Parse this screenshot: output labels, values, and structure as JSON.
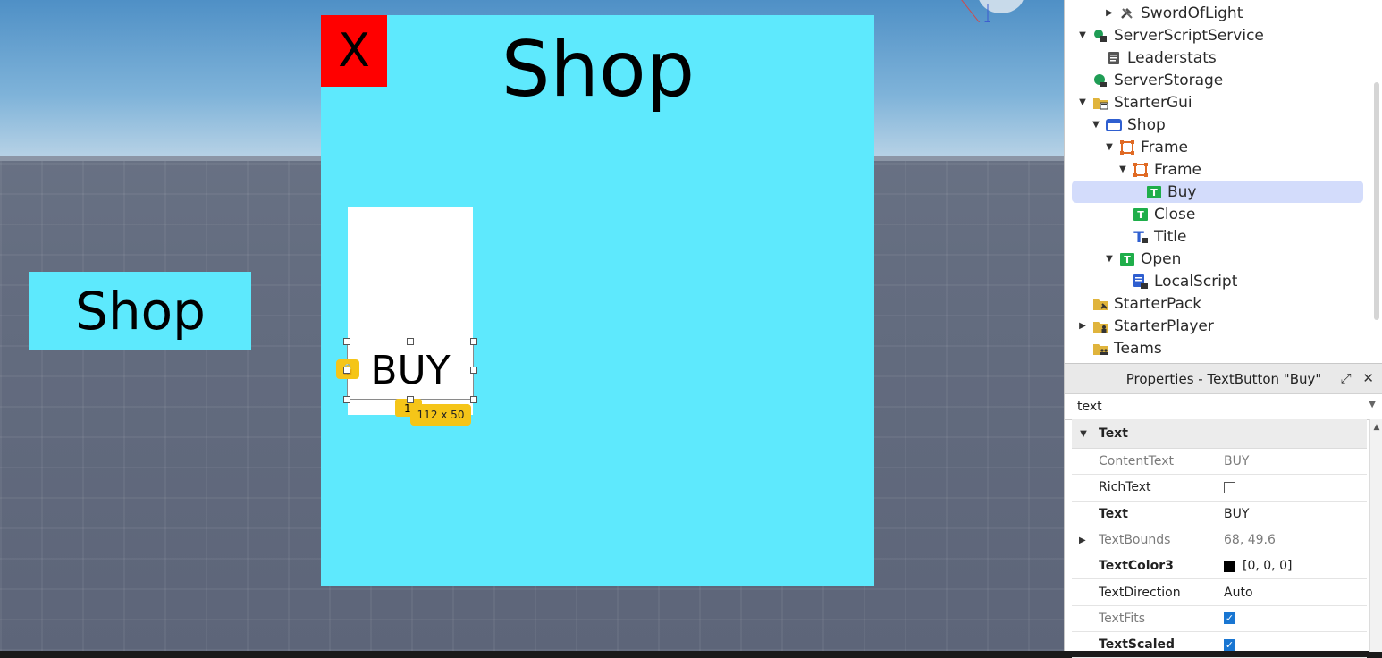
{
  "viewport": {
    "open_button": "Shop",
    "shop_frame": {
      "close_label": "X",
      "title": "Shop",
      "buy_label": "BUY",
      "size_tag": "112 x 50",
      "anchor_chip": "1"
    },
    "gizmo_axis": "Z"
  },
  "explorer": {
    "items": [
      {
        "label": "SwordOfLight",
        "icon": "tools-icon",
        "depth": 2,
        "arrow": "collapsed"
      },
      {
        "label": "ServerScriptService",
        "icon": "server-script-service-icon",
        "depth": 0,
        "arrow": "expanded"
      },
      {
        "label": "Leaderstats",
        "icon": "script-icon",
        "depth": 1,
        "arrow": "none"
      },
      {
        "label": "ServerStorage",
        "icon": "server-storage-icon",
        "depth": 0,
        "arrow": "none"
      },
      {
        "label": "StarterGui",
        "icon": "folder-gui-icon",
        "depth": 0,
        "arrow": "expanded"
      },
      {
        "label": "Shop",
        "icon": "screengui-icon",
        "depth": 1,
        "arrow": "expanded"
      },
      {
        "label": "Frame",
        "icon": "frame-icon",
        "depth": 2,
        "arrow": "expanded"
      },
      {
        "label": "Frame",
        "icon": "frame-icon",
        "depth": 3,
        "arrow": "expanded"
      },
      {
        "label": "Buy",
        "icon": "textbutton-icon",
        "depth": 4,
        "arrow": "none",
        "selected": true
      },
      {
        "label": "Close",
        "icon": "textbutton-icon",
        "depth": 3,
        "arrow": "none"
      },
      {
        "label": "Title",
        "icon": "textlabel-icon",
        "depth": 3,
        "arrow": "none"
      },
      {
        "label": "Open",
        "icon": "textbutton-icon",
        "depth": 2,
        "arrow": "expanded"
      },
      {
        "label": "LocalScript",
        "icon": "localscript-icon",
        "depth": 3,
        "arrow": "none"
      },
      {
        "label": "StarterPack",
        "icon": "folder-pack-icon",
        "depth": 0,
        "arrow": "none"
      },
      {
        "label": "StarterPlayer",
        "icon": "folder-player-icon",
        "depth": 0,
        "arrow": "collapsed"
      },
      {
        "label": "Teams",
        "icon": "folder-teams-icon",
        "depth": 0,
        "arrow": "none"
      }
    ]
  },
  "properties": {
    "header": "Properties - TextButton \"Buy\"",
    "filter_value": "text",
    "category": "Text",
    "rows": [
      {
        "name": "ContentText",
        "value": "BUY",
        "style": "dim"
      },
      {
        "name": "RichText",
        "type": "checkbox",
        "checked": false
      },
      {
        "name": "Text",
        "value": "BUY",
        "style": "bold"
      },
      {
        "name": "TextBounds",
        "value": "68, 49.6",
        "style": "dim",
        "expandable": true
      },
      {
        "name": "TextColor3",
        "value": "[0, 0, 0]",
        "style": "bold",
        "swatch": "#000000"
      },
      {
        "name": "TextDirection",
        "value": "Auto"
      },
      {
        "name": "TextFits",
        "type": "checkbox",
        "checked": true,
        "style": "dim"
      },
      {
        "name": "TextScaled",
        "type": "checkbox",
        "checked": true,
        "style": "bold"
      }
    ]
  },
  "colors": {
    "shop_bg": "#5ee9fd",
    "close_bg": "#ff0000",
    "selection": "#d3dcfb",
    "handle_chip": "#f5c518",
    "checkbox_on": "#1976d2"
  }
}
